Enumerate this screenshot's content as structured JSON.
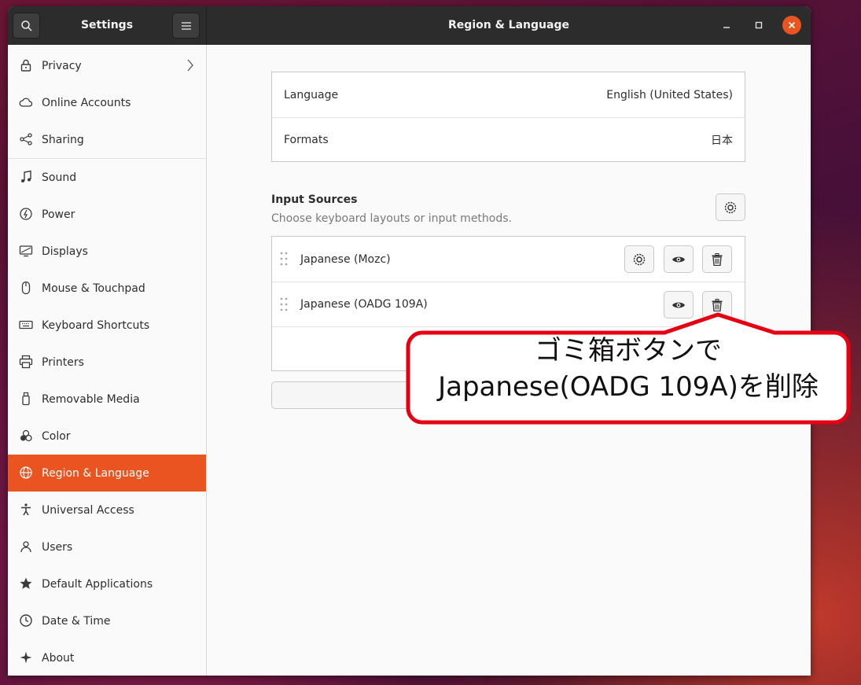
{
  "titlebar": {
    "app_title": "Settings",
    "page_title": "Region & Language"
  },
  "sidebar": {
    "items": [
      {
        "label": "Privacy",
        "icon": "lock-icon"
      },
      {
        "label": "Online Accounts",
        "icon": "cloud-icon"
      },
      {
        "label": "Sharing",
        "icon": "share-icon"
      },
      {
        "label": "Sound",
        "icon": "music-note-icon"
      },
      {
        "label": "Power",
        "icon": "power-icon"
      },
      {
        "label": "Displays",
        "icon": "display-icon"
      },
      {
        "label": "Mouse & Touchpad",
        "icon": "mouse-icon"
      },
      {
        "label": "Keyboard Shortcuts",
        "icon": "keyboard-icon"
      },
      {
        "label": "Printers",
        "icon": "printer-icon"
      },
      {
        "label": "Removable Media",
        "icon": "usb-icon"
      },
      {
        "label": "Color",
        "icon": "color-icon"
      },
      {
        "label": "Region & Language",
        "icon": "globe-icon",
        "active": true
      },
      {
        "label": "Universal Access",
        "icon": "accessibility-icon"
      },
      {
        "label": "Users",
        "icon": "users-icon"
      },
      {
        "label": "Default Applications",
        "icon": "star-icon"
      },
      {
        "label": "Date & Time",
        "icon": "clock-icon"
      },
      {
        "label": "About",
        "icon": "sparkle-icon"
      }
    ]
  },
  "region": {
    "language_label": "Language",
    "language_value": "English (United States)",
    "formats_label": "Formats",
    "formats_value": "日本"
  },
  "input_sources": {
    "title": "Input Sources",
    "subtitle": "Choose keyboard layouts or input methods.",
    "items": [
      {
        "label": "Japanese (Mozc)"
      },
      {
        "label": "Japanese (OADG 109A)"
      }
    ]
  },
  "callout": {
    "line1": "ゴミ箱ボタンで",
    "line2": "Japanese(OADG 109A)を削除"
  },
  "colors": {
    "accent": "#e95420",
    "callout_border": "#e60012"
  }
}
